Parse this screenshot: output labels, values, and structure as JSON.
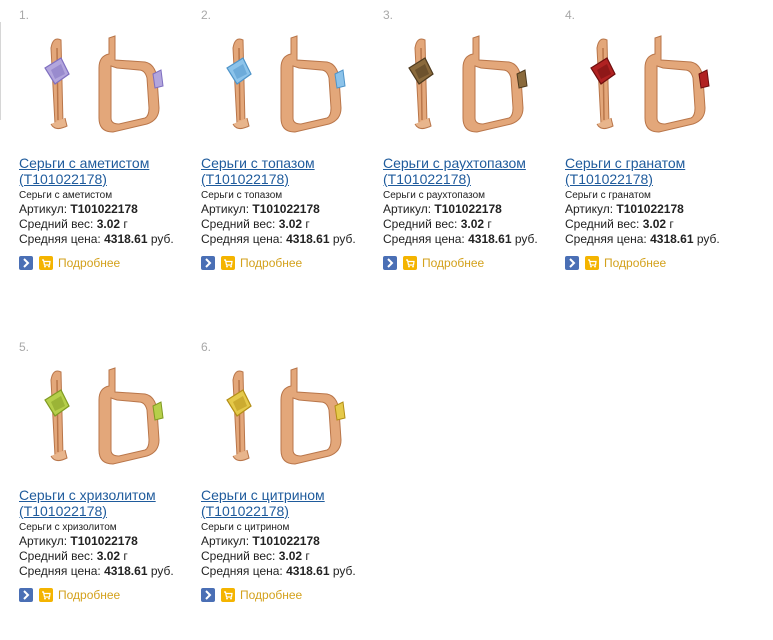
{
  "products": [
    {
      "num": "1.",
      "title_line1": "Серьги с аметистом",
      "title_line2": "(T101022178)",
      "subtitle": "Серьги с аметистом",
      "article_label": "Артикул:",
      "article": "T101022178",
      "weight_label": "Средний вес:",
      "weight": "3.02",
      "weight_unit": "г",
      "price_label": "Средняя цена:",
      "price": "4318.61",
      "price_unit": "руб.",
      "more_label": "Подробнее",
      "stone_color": "#b3a6dd",
      "stone_dark": "#7f6fc0"
    },
    {
      "num": "2.",
      "title_line1": "Серьги с топазом",
      "title_line2": "(T101022178)",
      "subtitle": "Серьги с топазом",
      "article_label": "Артикул:",
      "article": "T101022178",
      "weight_label": "Средний вес:",
      "weight": "3.02",
      "weight_unit": "г",
      "price_label": "Средняя цена:",
      "price": "4318.61",
      "price_unit": "руб.",
      "more_label": "Подробнее",
      "stone_color": "#8cc3ea",
      "stone_dark": "#4e94c9"
    },
    {
      "num": "3.",
      "title_line1": "Серьги с раухтопазом",
      "title_line2": "(T101022178)",
      "subtitle": "Серьги с раухтопазом",
      "article_label": "Артикул:",
      "article": "T101022178",
      "weight_label": "Средний вес:",
      "weight": "3.02",
      "weight_unit": "г",
      "price_label": "Средняя цена:",
      "price": "4318.61",
      "price_unit": "руб.",
      "more_label": "Подробнее",
      "stone_color": "#8a6a3c",
      "stone_dark": "#4e3a1e"
    },
    {
      "num": "4.",
      "title_line1": "Серьги с гранатом",
      "title_line2": "(T101022178)",
      "subtitle": "Серьги с гранатом",
      "article_label": "Артикул:",
      "article": "T101022178",
      "weight_label": "Средний вес:",
      "weight": "3.02",
      "weight_unit": "г",
      "price_label": "Средняя цена:",
      "price": "4318.61",
      "price_unit": "руб.",
      "more_label": "Подробнее",
      "stone_color": "#b02222",
      "stone_dark": "#6e0e0e"
    },
    {
      "num": "5.",
      "title_line1": "Серьги с хризолитом",
      "title_line2": "(T101022178)",
      "subtitle": "Серьги с хризолитом",
      "article_label": "Артикул:",
      "article": "T101022178",
      "weight_label": "Средний вес:",
      "weight": "3.02",
      "weight_unit": "г",
      "price_label": "Средняя цена:",
      "price": "4318.61",
      "price_unit": "руб.",
      "more_label": "Подробнее",
      "stone_color": "#b6cf4a",
      "stone_dark": "#7f9a22"
    },
    {
      "num": "6.",
      "title_line1": "Серьги с цитрином",
      "title_line2": "(T101022178)",
      "subtitle": "Серьги с цитрином",
      "article_label": "Артикул:",
      "article": "T101022178",
      "weight_label": "Средний вес:",
      "weight": "3.02",
      "weight_unit": "г",
      "price_label": "Средняя цена:",
      "price": "4318.61",
      "price_unit": "руб.",
      "more_label": "Подробнее",
      "stone_color": "#e5c94a",
      "stone_dark": "#b38e16"
    }
  ],
  "colors": {
    "link": "#1f5b9c",
    "more": "#d3a11c",
    "gold": "#e3a77a",
    "gold_dark": "#b9764a"
  }
}
